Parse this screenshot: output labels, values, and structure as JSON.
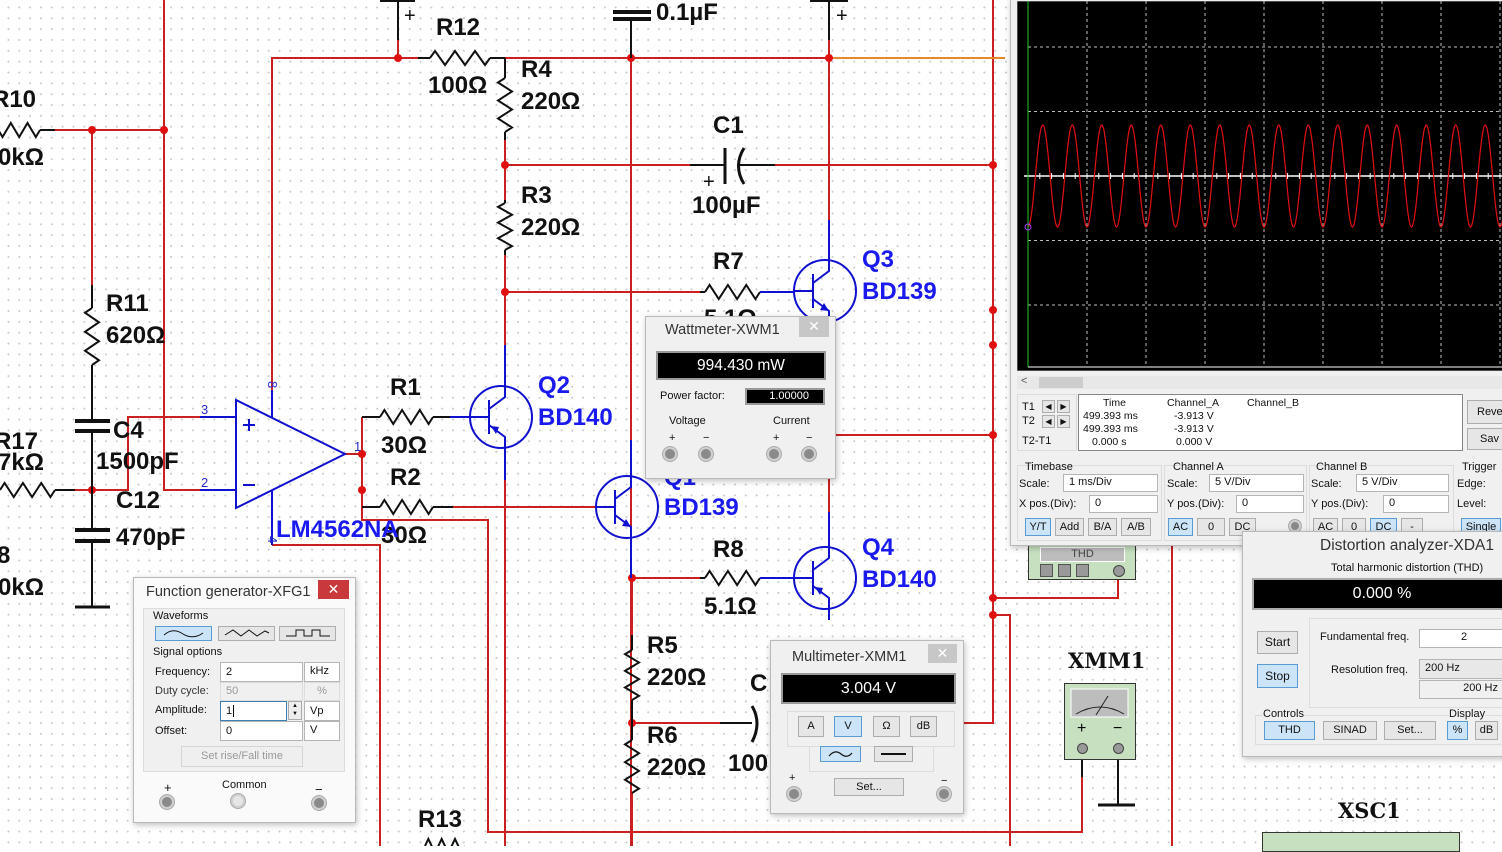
{
  "schematic": {
    "labels": {
      "r10": "R10",
      "r10_val": "0kΩ",
      "r11": "R11",
      "r11_val": "620Ω",
      "r17": "R17",
      "r17_val": "7kΩ",
      "c4": "C4",
      "c4_val": "1500pF",
      "c12": "C12",
      "c12_val": "470pF",
      "r18": "8",
      "r18_val": "0kΩ",
      "r12": "R12",
      "r12_val": "100Ω",
      "r4": "R4",
      "r4_val": "220Ω",
      "r3": "R3",
      "r3_val": "220Ω",
      "c_top": "0.1µF",
      "c1": "C1",
      "c1_val": "100µF",
      "r7": "R7",
      "r7_val": "5.1Ω",
      "q3": "Q3",
      "q3_val": "BD139",
      "r1": "R1",
      "r1_val": "30Ω",
      "r2": "R2",
      "r2_val": "30Ω",
      "q2": "Q2",
      "q2_val": "BD140",
      "q1": "Q1",
      "q1_val": "BD139",
      "r8": "R8",
      "r8_val": "5.1Ω",
      "q4": "Q4",
      "q4_val": "BD140",
      "r5": "R5",
      "r5_val": "220Ω",
      "r6": "R6",
      "r6_val": "220Ω",
      "c2": "C",
      "c2_val": "100",
      "r13": "R13",
      "opamp": "LM4562NA",
      "pin3": "3",
      "pin2": "2",
      "pin1": "1",
      "pin8": "8",
      "pin4": "4",
      "plus": "+",
      "xmm1": "XMM1",
      "xsc1": "XSC1",
      "xda_display": "THD"
    },
    "colors": {
      "wire": "#cc1f1f",
      "component": "#1010d0",
      "probe_wire": "#e8862a"
    }
  },
  "oscilloscope": {
    "scroll_left": "<",
    "t1": "T1",
    "t2": "T2",
    "t2_t1": "T2-T1",
    "arrow_left": "◀",
    "arrow_right": "▶",
    "headers": [
      "Time",
      "Channel_A",
      "Channel_B"
    ],
    "rows": [
      [
        "499.393 ms",
        "-3.913 V",
        ""
      ],
      [
        "499.393 ms",
        "-3.913 V",
        ""
      ],
      [
        "0.000 s",
        "0.000 V",
        ""
      ]
    ],
    "reverse_label": "Reve",
    "save_label": "Sav",
    "timebase": {
      "title": "Timebase",
      "scale_label": "Scale:",
      "scale": "1 ms/Div",
      "xpos_label": "X pos.(Div):",
      "xpos": "0",
      "modes": [
        "Y/T",
        "Add",
        "B/A",
        "A/B"
      ],
      "selected": "Y/T"
    },
    "channel_a": {
      "title": "Channel A",
      "scale_label": "Scale:",
      "scale": "5  V/Div",
      "ypos_label": "Y pos.(Div):",
      "ypos": "0",
      "coupling": [
        "AC",
        "0",
        "DC"
      ],
      "selected": "AC"
    },
    "channel_b": {
      "title": "Channel B",
      "scale_label": "Scale:",
      "scale": "5  V/Div",
      "ypos_label": "Y pos.(Div):",
      "ypos": "0",
      "coupling": [
        "AC",
        "0",
        "DC",
        "-"
      ],
      "selected": "DC"
    },
    "trigger": {
      "title": "Trigger",
      "edge_label": "Edge:",
      "level_label": "Level:",
      "single_label": "Single"
    },
    "trace_color": "#e01010"
  },
  "chart_data": {
    "type": "line",
    "series": [
      {
        "name": "Channel_A",
        "waveform": "sine",
        "frequency_hz": 2000,
        "amplitude_v": 3.95,
        "start_phase": "minimum"
      }
    ],
    "x_scale": "1 ms/Div",
    "y_scale": "5 V/Div",
    "x_divisions": 10,
    "y_divisions": 8,
    "grid": true
  },
  "distortion_analyzer": {
    "title": "Distortion analyzer-XDA1",
    "display_label": "Total harmonic distortion (THD)",
    "value": "0.000 %",
    "start": "Start",
    "stop": "Stop",
    "fund_label": "Fundamental freq.",
    "fund_value": "2",
    "res_label": "Resolution freq.",
    "res_value": "200 Hz",
    "res_value2": "200 Hz",
    "controls_label": "Controls",
    "thd": "THD",
    "sinad": "SINAD",
    "set": "Set...",
    "display_title": "Display",
    "percent": "%",
    "db": "dB"
  },
  "function_generator": {
    "title": "Function generator-XFG1",
    "close": "✕",
    "waveforms_label": "Waveforms",
    "waveforms": [
      "sine",
      "triangle",
      "square"
    ],
    "selected_waveform": "sine",
    "signal_options_label": "Signal options",
    "fields": [
      {
        "label": "Frequency:",
        "value": "2",
        "unit": "kHz"
      },
      {
        "label": "Duty cycle:",
        "value": "50",
        "unit": "%"
      },
      {
        "label": "Amplitude:",
        "value": "1",
        "unit": "Vp"
      },
      {
        "label": "Offset:",
        "value": "0",
        "unit": "V"
      }
    ],
    "rise_fall": "Set rise/Fall time",
    "plus": "+",
    "common": "Common",
    "minus": "−"
  },
  "wattmeter": {
    "title": "Wattmeter-XWM1",
    "close": "✕",
    "value": "994.430 mW",
    "pf_label": "Power factor:",
    "pf_value": "1.00000",
    "voltage": "Voltage",
    "current": "Current",
    "plus": "+",
    "minus": "−"
  },
  "multimeter": {
    "title": "Multimeter-XMM1",
    "close": "✕",
    "value": "3.004 V",
    "modes": [
      "A",
      "V",
      "Ω",
      "dB"
    ],
    "selected_mode": "V",
    "set": "Set...",
    "plus": "+",
    "minus": "−",
    "selected_coupling": "ac"
  },
  "xmm1_symbol": {
    "plus": "+",
    "minus": "−"
  }
}
